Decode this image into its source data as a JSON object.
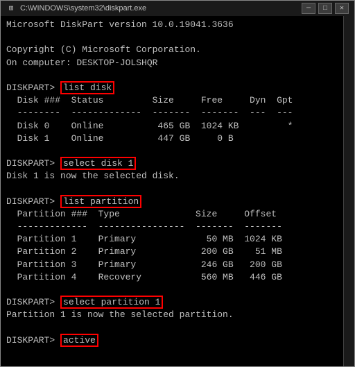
{
  "window": {
    "title": "C:\\WINDOWS\\system32\\diskpart.exe",
    "minimize_label": "─",
    "maximize_label": "□",
    "close_label": "✕"
  },
  "terminal": {
    "line1": "Microsoft DiskPart version 10.0.19041.3636",
    "line2": "",
    "line3": "Copyright (C) Microsoft Corporation.",
    "line4": "On computer: DESKTOP-JOLSHQR",
    "line5": "",
    "cmd1_prompt": "DISKPART> ",
    "cmd1_text": "list disk",
    "table1_header": "  Disk ###  Status         Size     Free     Dyn  Gpt",
    "table1_sep": "  --------  -------------  -------  -------  ---  ---",
    "table1_row1": "  Disk 0    Online          465 GB  1024 KB         *",
    "table1_row2": "  Disk 1    Online          447 GB     0 B",
    "line_blank1": "",
    "cmd2_prompt": "DISKPART> ",
    "cmd2_text": "select disk 1",
    "cmd2_result": "Disk 1 is now the selected disk.",
    "line_blank2": "",
    "cmd3_prompt": "DISKPART> ",
    "cmd3_text": "list partition",
    "table2_header": "  Partition ###  Type              Size     Offset",
    "table2_sep": "  -------------  ----------------  -------  -------",
    "table2_row1": "  Partition 1    Primary             50 MB  1024 KB",
    "table2_row2": "  Partition 2    Primary            200 GB    51 MB",
    "table2_row3": "  Partition 3    Primary            246 GB   200 GB",
    "table2_row4": "  Partition 4    Recovery           560 MB   446 GB",
    "line_blank3": "",
    "cmd4_prompt": "DISKPART> ",
    "cmd4_text": "select partition 1",
    "cmd4_result": "Partition 1 is now the selected partition.",
    "line_blank4": "",
    "cmd5_prompt": "DISKPART> ",
    "cmd5_text": "active"
  },
  "colors": {
    "bg": "#000000",
    "text": "#c0c0c0",
    "highlight_border": "#ff0000",
    "title_bg": "#1a1a1a"
  }
}
